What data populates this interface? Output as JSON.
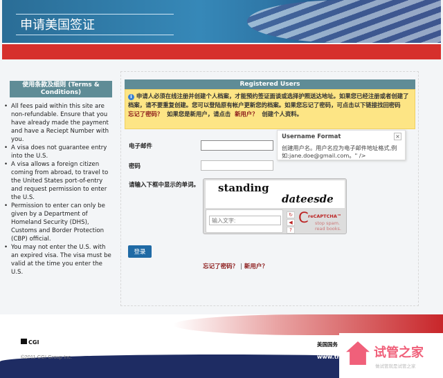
{
  "header": {
    "title": "申请美国签证"
  },
  "terms": {
    "title": "使用条款及细则 (Terms & Conditions)",
    "items": [
      "All fees paid within this site are non-refundable. Ensure that you have already made the payment and have a Reciept Number with you.",
      "A visa does not guarantee entry into the U.S.",
      "A visa allows a foreign citizen coming from abroad, to travel to the United States port-of-entry and request permission to enter the U.S.",
      "Permission to enter can only be given by a Department of Homeland Security (DHS), Customs and Border Protection (CBP) official.",
      "You may not enter the U.S. with an expired visa. The visa must be valid at the time you enter the U.S."
    ]
  },
  "login": {
    "section_title": "Registered Users",
    "notice_text": "申请人必须在线注册并创建个人档案，才能预约签证面谈或选择护照送达地址。如果您已经注册或者创建了档案，请不要重复创建。您可以登陆原有帐户更新您的档案。如果您忘记了密码，可点击以下链接找回密码",
    "notice_forgot": "忘记了密码？",
    "notice_mid": "如果您是新用户，请点击",
    "notice_new": "新用户？",
    "notice_end": "创建个人资料。",
    "email_label": "电子邮件",
    "email_value": "",
    "password_label": "密码",
    "captcha_label": "请输入下框中显示的单词。",
    "captcha_word1": "standing",
    "captcha_word2": "dateesde",
    "captcha_placeholder": "输入文字:",
    "recaptcha_brand": "reCAPTCHA™",
    "recaptcha_slogan": "stop spam. read books.",
    "login_button": "登录",
    "forgot_link": "忘记了密码？",
    "separator": "|",
    "new_user_link": "新用户？"
  },
  "tooltip": {
    "title": "Username Format",
    "body": "创建用户名。用户名应为电子邮件地址格式,例如:jane.doe@gmail.com。\" />",
    "close": "×"
  },
  "footer": {
    "logo": "CGI",
    "copyright": "©2011 CGI Group Inc.",
    "text": "美国国务",
    "url": "www.tr"
  },
  "watermark": {
    "name": "试管之家",
    "slogan": "做试管就是试管之家"
  },
  "colors": {
    "header_red": "#d6302c",
    "section_bar": "#5f8c96",
    "notice_bg": "#fde585",
    "button": "#1f6aa5",
    "link": "#8b1a1a",
    "footer_navy": "#1e2c63"
  }
}
